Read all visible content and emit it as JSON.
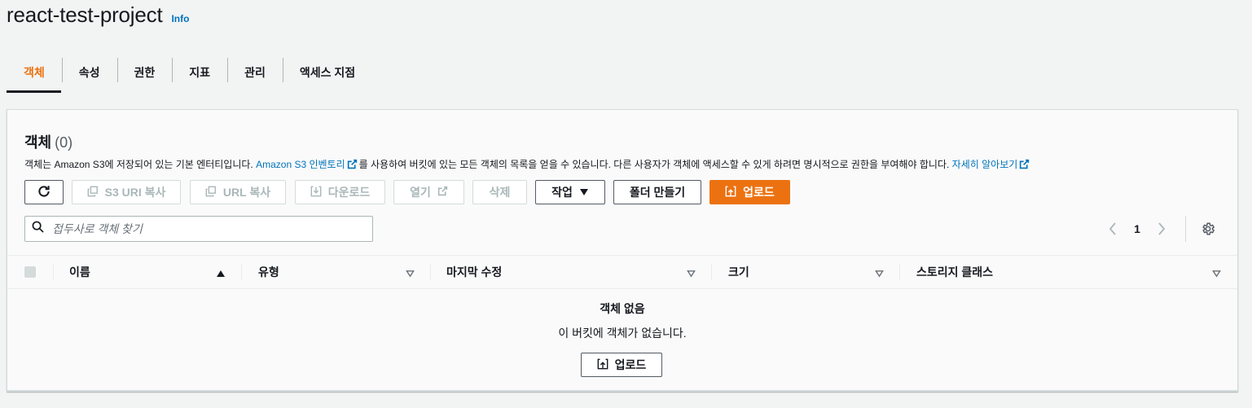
{
  "header": {
    "title": "react-test-project",
    "info_label": "Info"
  },
  "tabs": [
    {
      "label": "객체",
      "active": true
    },
    {
      "label": "속성",
      "active": false
    },
    {
      "label": "권한",
      "active": false
    },
    {
      "label": "지표",
      "active": false
    },
    {
      "label": "관리",
      "active": false
    },
    {
      "label": "액세스 지점",
      "active": false
    }
  ],
  "objects_panel": {
    "title": "객체",
    "count": "(0)",
    "description_part1": "객체는 Amazon S3에 저장되어 있는 기본 엔터티입니다. ",
    "inventory_link": "Amazon S3 인벤토리",
    "description_part2": "를 사용하여 버킷에 있는 모든 객체의 목록을 얻을 수 있습니다. 다른 사용자가 객체에 액세스할 수 있게 하려면 명시적으로 권한을 부여해야 합니다. ",
    "learn_more_link": "자세히 알아보기"
  },
  "toolbar": {
    "refresh_icon": "refresh-icon",
    "copy_s3_uri": "S3 URI 복사",
    "copy_url": "URL 복사",
    "download": "다운로드",
    "open": "열기",
    "delete": "삭제",
    "actions": "작업",
    "create_folder": "폴더 만들기",
    "upload": "업로드"
  },
  "search": {
    "placeholder": "접두사로 객체 찾기",
    "value": ""
  },
  "pagination": {
    "current_page": "1"
  },
  "table": {
    "columns": [
      "이름",
      "유형",
      "마지막 수정",
      "크기",
      "스토리지 클래스"
    ]
  },
  "empty_state": {
    "title": "객체 없음",
    "description": "이 버킷에 객체가 없습니다.",
    "upload_label": "업로드"
  },
  "colors": {
    "accent": "#ec7211",
    "link": "#0073bb",
    "text": "#16191f",
    "background": "#f2f3f3"
  }
}
